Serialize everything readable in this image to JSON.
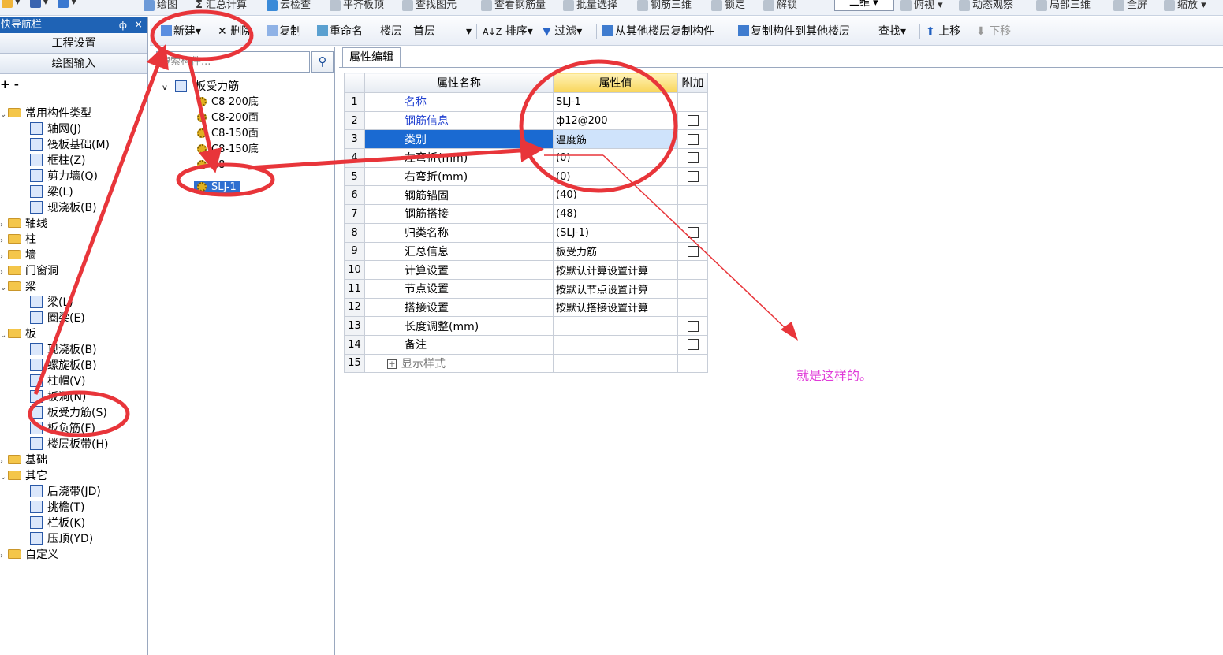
{
  "top_toolbar": {
    "items": [
      "绘图",
      "汇总计算",
      "云检查",
      "平齐板顶",
      "查找图元",
      "查看钢筋量",
      "批量选择",
      "钢筋三维",
      "锁定",
      "解锁"
    ],
    "view_mode": "二维",
    "view_items": [
      "俯视",
      "动态观察",
      "局部三维",
      "全屏",
      "缩放"
    ]
  },
  "nav": {
    "title": "快导航栏",
    "pin": "ф",
    "close": "×",
    "btn_settings": "工程设置",
    "btn_drawing": "绘图输入",
    "expand_tools": "+ -",
    "tree": [
      {
        "label": "常用构件类型",
        "level": 0,
        "type": "folder",
        "expanded": true
      },
      {
        "label": "轴网(J)",
        "level": 1,
        "type": "item"
      },
      {
        "label": "筏板基础(M)",
        "level": 1,
        "type": "item"
      },
      {
        "label": "框柱(Z)",
        "level": 1,
        "type": "item"
      },
      {
        "label": "剪力墙(Q)",
        "level": 1,
        "type": "item"
      },
      {
        "label": "梁(L)",
        "level": 1,
        "type": "item"
      },
      {
        "label": "现浇板(B)",
        "level": 1,
        "type": "item"
      },
      {
        "label": "轴线",
        "level": 0,
        "type": "folder",
        "expanded": false
      },
      {
        "label": "柱",
        "level": 0,
        "type": "folder",
        "expanded": false
      },
      {
        "label": "墙",
        "level": 0,
        "type": "folder",
        "expanded": false
      },
      {
        "label": "门窗洞",
        "level": 0,
        "type": "folder",
        "expanded": false
      },
      {
        "label": "梁",
        "level": 0,
        "type": "folder",
        "expanded": true
      },
      {
        "label": "梁(L)",
        "level": 1,
        "type": "item"
      },
      {
        "label": "圈梁(E)",
        "level": 1,
        "type": "item"
      },
      {
        "label": "板",
        "level": 0,
        "type": "folder",
        "expanded": true
      },
      {
        "label": "现浇板(B)",
        "level": 1,
        "type": "item"
      },
      {
        "label": "螺旋板(B)",
        "level": 1,
        "type": "item"
      },
      {
        "label": "柱帽(V)",
        "level": 1,
        "type": "item"
      },
      {
        "label": "板洞(N)",
        "level": 1,
        "type": "item"
      },
      {
        "label": "板受力筋(S)",
        "level": 1,
        "type": "item"
      },
      {
        "label": "板负筋(F)",
        "level": 1,
        "type": "item"
      },
      {
        "label": "楼层板带(H)",
        "level": 1,
        "type": "item"
      },
      {
        "label": "基础",
        "level": 0,
        "type": "folder",
        "expanded": false
      },
      {
        "label": "其它",
        "level": 0,
        "type": "folder",
        "expanded": true
      },
      {
        "label": "后浇带(JD)",
        "level": 1,
        "type": "item"
      },
      {
        "label": "挑檐(T)",
        "level": 1,
        "type": "item"
      },
      {
        "label": "栏板(K)",
        "level": 1,
        "type": "item"
      },
      {
        "label": "压顶(YD)",
        "level": 1,
        "type": "item"
      },
      {
        "label": "自定义",
        "level": 0,
        "type": "folder",
        "expanded": false
      }
    ]
  },
  "comp_toolbar": {
    "new": "新建",
    "delete": "删除",
    "copy": "复制",
    "rename": "重命名",
    "floor_label": "楼层",
    "floor_value": "首层",
    "sort": "排序",
    "filter": "过滤",
    "copy_from_floor": "从其他楼层复制构件",
    "copy_to_floor": "复制构件到其他楼层",
    "find": "查找",
    "move_up": "上移",
    "move_down": "下移"
  },
  "comp_tree": {
    "search_placeholder": "搜索构件...",
    "root": "板受力筋",
    "items": [
      "C8-200底",
      "C8-200面",
      "C8-150面",
      "C8-150底",
      "C8",
      "SLJ-1"
    ],
    "selected": "SLJ-1"
  },
  "props": {
    "tab": "属性编辑",
    "headers": {
      "name": "属性名称",
      "value": "属性值",
      "extra": "附加"
    },
    "rows": [
      {
        "no": "1",
        "name": "名称",
        "value": "SLJ-1",
        "blue": true,
        "checkbox": false
      },
      {
        "no": "2",
        "name": "钢筋信息",
        "value": "ф12@200",
        "blue": true,
        "checkbox": true
      },
      {
        "no": "3",
        "name": "类别",
        "value": "温度筋",
        "blue": true,
        "checkbox": true
      },
      {
        "no": "4",
        "name": "左弯折(mm)",
        "value": "(0)",
        "blue": false,
        "checkbox": true
      },
      {
        "no": "5",
        "name": "右弯折(mm)",
        "value": "(0)",
        "blue": false,
        "checkbox": true
      },
      {
        "no": "6",
        "name": "钢筋锚固",
        "value": "(40)",
        "blue": false,
        "checkbox": false
      },
      {
        "no": "7",
        "name": "钢筋搭接",
        "value": "(48)",
        "blue": false,
        "checkbox": false
      },
      {
        "no": "8",
        "name": "归类名称",
        "value": "(SLJ-1)",
        "blue": false,
        "checkbox": true
      },
      {
        "no": "9",
        "name": "汇总信息",
        "value": "板受力筋",
        "blue": false,
        "checkbox": true
      },
      {
        "no": "10",
        "name": "计算设置",
        "value": "按默认计算设置计算",
        "blue": false,
        "checkbox": false
      },
      {
        "no": "11",
        "name": "节点设置",
        "value": "按默认节点设置计算",
        "blue": false,
        "checkbox": false
      },
      {
        "no": "12",
        "name": "搭接设置",
        "value": "按默认搭接设置计算",
        "blue": false,
        "checkbox": false
      },
      {
        "no": "13",
        "name": "长度调整(mm)",
        "value": "",
        "blue": false,
        "checkbox": true
      },
      {
        "no": "14",
        "name": "备注",
        "value": "",
        "blue": false,
        "checkbox": true
      },
      {
        "no": "15",
        "name": "显示样式",
        "value": "",
        "blue": false,
        "checkbox": false,
        "expandable": true
      }
    ],
    "selected_row": "3"
  },
  "annotation": {
    "text": "就是这样的。",
    "color": "#e03bd8",
    "marker_color": "#e8353a"
  }
}
